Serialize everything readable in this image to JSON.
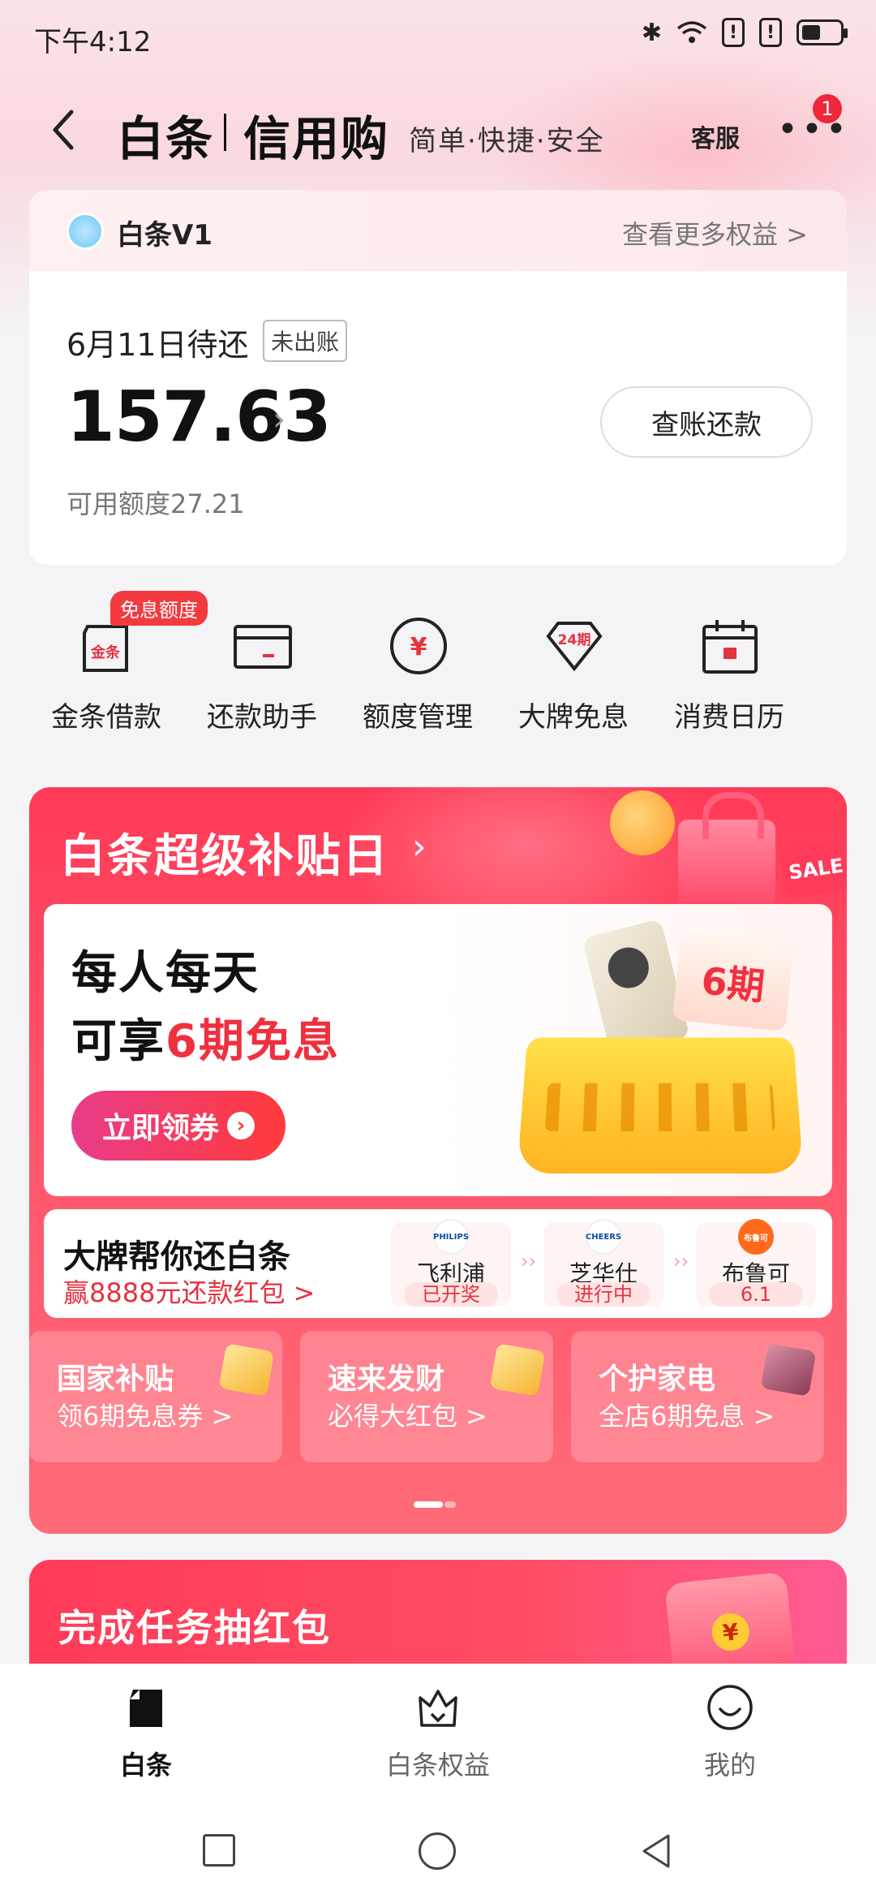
{
  "status_bar": {
    "time": "下午4:12",
    "icons": [
      "bluetooth-icon",
      "wifi-icon",
      "alert-icon",
      "alert-icon",
      "battery-icon"
    ]
  },
  "header": {
    "title_main": "白条",
    "title_sub": "信用购",
    "slogan": "简单·快捷·安全",
    "service_label": "客服",
    "more_badge": "1"
  },
  "level": {
    "name": "白条V1",
    "more_label": "查看更多权益 >"
  },
  "bill": {
    "due_label": "6月11日待还",
    "status_tag": "未出账",
    "amount": "157.63",
    "available": "可用额度27.21",
    "repay_button": "查账还款"
  },
  "quick_actions": [
    {
      "label": "金条借款",
      "tag": "免息额度",
      "icon": "jintiao-icon"
    },
    {
      "label": "还款助手",
      "icon": "card-icon"
    },
    {
      "label": "额度管理",
      "icon": "yuan-circle-icon"
    },
    {
      "label": "大牌免息",
      "icon_text": "24期",
      "icon": "diamond-tag-icon"
    },
    {
      "label": "消费日历",
      "icon": "calendar-icon"
    }
  ],
  "subsidy": {
    "title": "白条超级补贴日",
    "sale_label": "SALE",
    "promo_line1": "每人每天",
    "promo_line2_prefix": "可享",
    "promo_line2_highlight": "6期免息",
    "basket_label": "6期",
    "coupon_button": "立即领券",
    "brand": {
      "title": "大牌帮你还白条",
      "subtitle": "赢8888元还款红包 >",
      "items": [
        {
          "name": "飞利浦",
          "logo": "PHILIPS",
          "status": "已开奖"
        },
        {
          "name": "芝华仕",
          "logo": "CHEERS",
          "status": "进行中"
        },
        {
          "name": "布鲁可",
          "logo": "布鲁可",
          "status": "6.1"
        }
      ]
    },
    "mini_cards": [
      {
        "title": "国家补贴",
        "subtitle": "领6期免息券 >"
      },
      {
        "title": "速来发财",
        "subtitle": "必得大红包 >"
      },
      {
        "title": "个护家电",
        "subtitle": "全店6期免息 >"
      }
    ]
  },
  "task_banner": {
    "title": "完成任务抽红包"
  },
  "tabbar": [
    {
      "label": "白条",
      "active": true
    },
    {
      "label": "白条权益",
      "active": false
    },
    {
      "label": "我的",
      "active": false
    }
  ],
  "colors": {
    "brand_red": "#f0303f",
    "accent_pink": "#ff3a57",
    "text_dark": "#111111"
  }
}
